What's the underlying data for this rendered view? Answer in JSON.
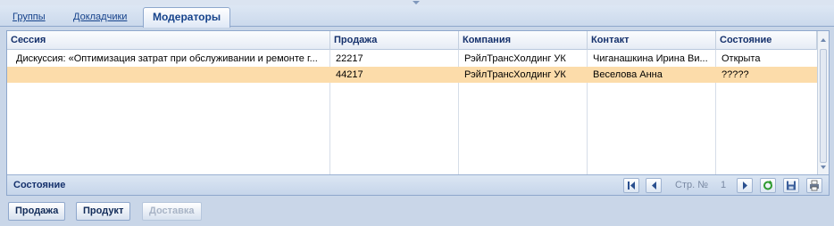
{
  "tabs": [
    {
      "label": "Группы",
      "active": false
    },
    {
      "label": "Докладчики",
      "active": false
    },
    {
      "label": "Модераторы",
      "active": true
    }
  ],
  "grid": {
    "columns": [
      "Сессия",
      "Продажа",
      "Компания",
      "Контакт",
      "Состояние"
    ],
    "rows": [
      [
        "Дискуссия: «Оптимизация затрат при обслуживании и ремонте г...",
        "22217",
        "РэйлТрансХолдинг УК",
        "Чиганашкина Ирина Ви...",
        "Открыта"
      ],
      [
        "",
        "44217",
        "РэйлТрансХолдинг УК",
        "Веселова Анна",
        "?????"
      ]
    ],
    "selected_row": 1,
    "selected_row_color": "#fcdcaa"
  },
  "footer": {
    "label": "Состояние",
    "page_label": "Стр. №",
    "page_number": "1"
  },
  "buttons": [
    {
      "label": "Продажа",
      "enabled": true
    },
    {
      "label": "Продукт",
      "enabled": true
    },
    {
      "label": "Доставка",
      "enabled": false
    }
  ],
  "icons": [
    "first-page-icon",
    "prev-page-icon",
    "next-page-icon",
    "refresh-icon",
    "save-icon",
    "print-icon"
  ],
  "colors": {
    "accent": "#15428b",
    "background": "#c9d6e8"
  }
}
